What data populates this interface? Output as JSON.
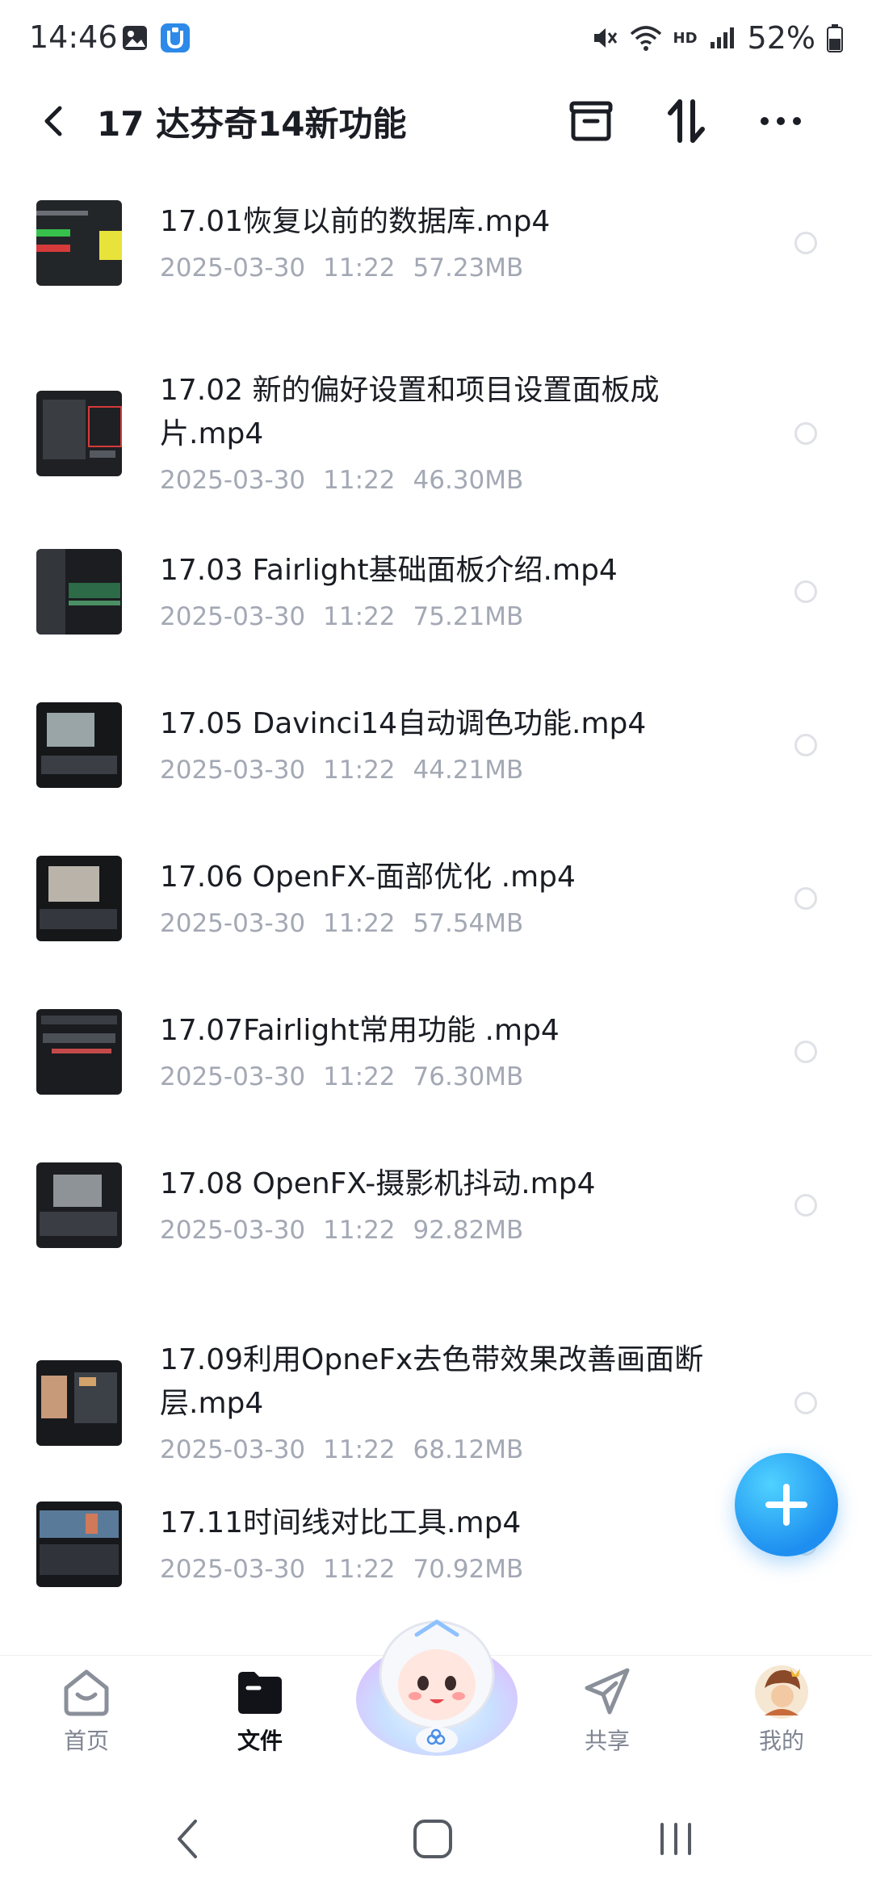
{
  "status": {
    "time": "14:46",
    "hd_label": "HD",
    "battery": "52%"
  },
  "header": {
    "title": "17 达芬奇14新功能",
    "icons": [
      "back-icon",
      "archive-icon",
      "sort-icon",
      "more-icon"
    ]
  },
  "files": [
    {
      "name": "17.01恢复以前的数据库.mp4",
      "date": "2025-03-30",
      "time": "11:22",
      "size": "57.23MB"
    },
    {
      "name": "17.02 新的偏好设置和项目设置面板成片.mp4",
      "date": "2025-03-30",
      "time": "11:22",
      "size": "46.30MB"
    },
    {
      "name": "17.03 Fairlight基础面板介绍.mp4",
      "date": "2025-03-30",
      "time": "11:22",
      "size": "75.21MB"
    },
    {
      "name": "17.05 Davinci14自动调色功能.mp4",
      "date": "2025-03-30",
      "time": "11:22",
      "size": "44.21MB"
    },
    {
      "name": "17.06 OpenFX-面部优化 .mp4",
      "date": "2025-03-30",
      "time": "11:22",
      "size": "57.54MB"
    },
    {
      "name": "17.07Fairlight常用功能 .mp4",
      "date": "2025-03-30",
      "time": "11:22",
      "size": "76.30MB"
    },
    {
      "name": "17.08 OpenFX-摄影机抖动.mp4",
      "date": "2025-03-30",
      "time": "11:22",
      "size": "92.82MB"
    },
    {
      "name": "17.09利用OpneFx去色带效果改善画面断层.mp4",
      "date": "2025-03-30",
      "time": "11:22",
      "size": "68.12MB"
    },
    {
      "name": "17.11时间线对比工具.mp4",
      "date": "2025-03-30",
      "time": "11:22",
      "size": "70.92MB"
    }
  ],
  "nav": {
    "home": "首页",
    "files": "文件",
    "share": "共享",
    "mine": "我的"
  },
  "colors": {
    "accent": "#1e8ff0",
    "meta_text": "#a3a8b4"
  }
}
